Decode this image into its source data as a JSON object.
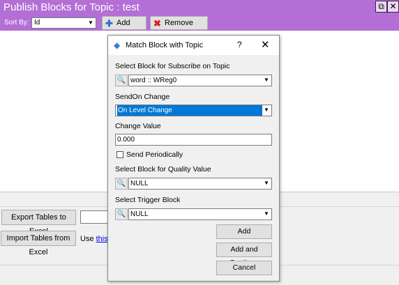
{
  "window": {
    "title": "Publish Blocks for Topic : test",
    "restore_icon": "restore-icon",
    "close_icon": "close-icon",
    "accent": "#b36fd6"
  },
  "toolbar": {
    "sort_label": "Sort By:",
    "sort_value": "Id",
    "add_entry": "Add Entry",
    "remove_entry": "Remove Entry"
  },
  "bottom": {
    "export_label": "Export Tables to Excel",
    "import_label": "Import Tables from Excel",
    "use_text": "Use ",
    "this_link": "this",
    "after_link": " te"
  },
  "dialog": {
    "title": "Match Block with Topic",
    "help": "?",
    "close": "✕",
    "select_block_label": "Select Block for Subscribe on Topic",
    "select_block_value": "word :: WReg0",
    "sendon_label": "SendOn Change",
    "sendon_value": "On Level Change",
    "change_value_label": "Change Value",
    "change_value": "0.000",
    "send_periodically": "Send Periodically",
    "quality_label": "Select Block for Quality Value",
    "quality_value": "NULL",
    "trigger_label": "Select Trigger Block",
    "trigger_value": "NULL",
    "add": "Add",
    "add_continue": "Add and Continue",
    "cancel": "Cancel"
  }
}
